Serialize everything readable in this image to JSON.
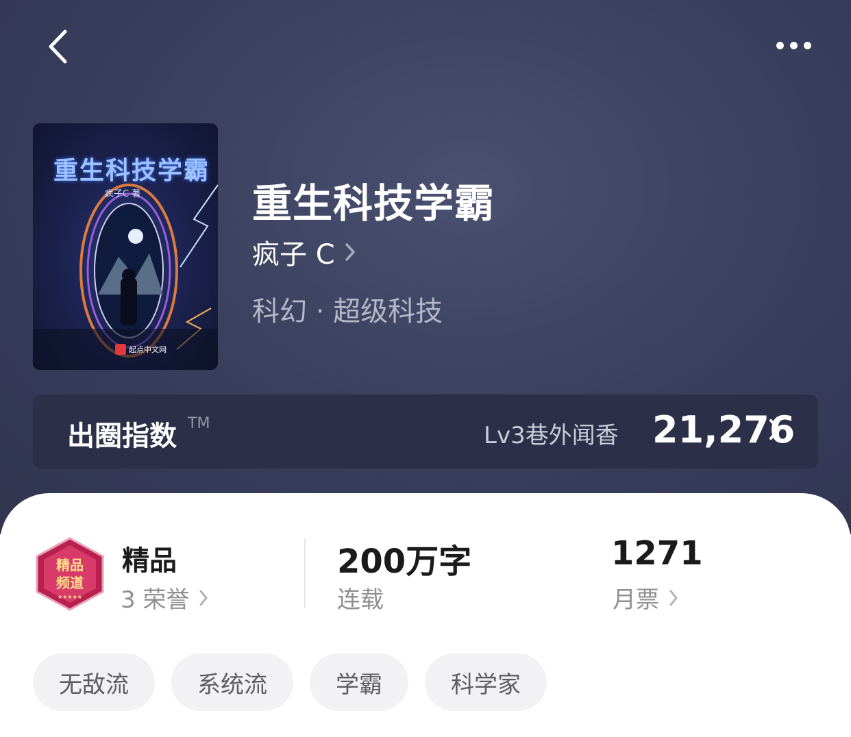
{
  "nav": {
    "back_icon": "chevron-left-icon",
    "more_icon": "more-horizontal-icon"
  },
  "book": {
    "title": "重生科技学霸",
    "author": "疯子 C",
    "category": "科幻 · 超级科技",
    "cover": {
      "title": "重生科技学霸",
      "author": "疯子C 著",
      "publisher": "起点中文网"
    }
  },
  "circle_index": {
    "label": "出圈指数",
    "trademark": "TM",
    "level": "Lv3巷外闻香",
    "value": "21,276"
  },
  "stats": {
    "quality": {
      "badge_text": "精品频道",
      "title": "精品",
      "sub": "3 荣誉"
    },
    "words": {
      "title": "200万字",
      "sub": "连载"
    },
    "tickets": {
      "title": "1271",
      "sub": "月票"
    }
  },
  "tags": [
    "无敌流",
    "系统流",
    "学霸",
    "科学家"
  ],
  "colors": {
    "hero_bg": "#3c4260",
    "index_bar": "#2b3048",
    "tag_bg": "#f2f2f4",
    "badge": "#b8204f"
  }
}
